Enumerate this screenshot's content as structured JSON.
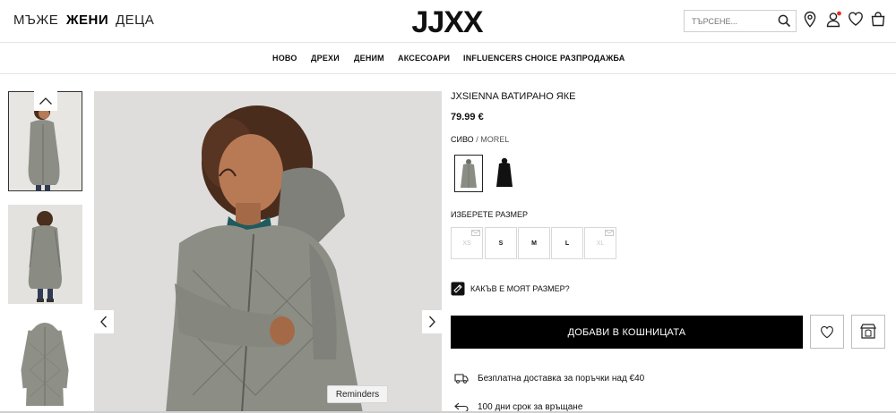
{
  "header": {
    "genders": [
      "МЪЖЕ",
      "ЖЕНИ",
      "ДЕЦА"
    ],
    "active_gender": "ЖЕНИ",
    "logo_text": "JJXX",
    "search_placeholder": "ТЪРСЕНЕ...",
    "icons": [
      "search-icon",
      "location-icon",
      "user-icon",
      "heart-icon",
      "bag-icon"
    ],
    "notification_color": "#e0312b"
  },
  "nav": {
    "items": [
      "НОВО",
      "ДРЕХИ",
      "ДЕНИМ",
      "АКСЕСОАРИ",
      "INFLUENCERS CHOICE",
      "РАЗПРОДАЖБА"
    ]
  },
  "product": {
    "title": "JXSIENNA ВАТИРАНО ЯКЕ",
    "price": "79.99 €",
    "color_label": "СИВО",
    "color_name": "/ MOREL",
    "swatches": [
      {
        "name": "grey",
        "color": "#8a8d84",
        "selected": true
      },
      {
        "name": "black",
        "color": "#111111",
        "selected": false
      }
    ],
    "size_label": "ИЗБЕРЕТЕ РАЗМЕР",
    "sizes": [
      {
        "label": "XS",
        "available": false
      },
      {
        "label": "S",
        "available": true
      },
      {
        "label": "M",
        "available": true
      },
      {
        "label": "L",
        "available": true
      },
      {
        "label": "XL",
        "available": false
      }
    ],
    "size_guide": "КАКЪВ Е МОЯТ РАЗМЕР?",
    "add_to_bag": "ДОБАВИ В КОШНИЦАТА",
    "delivery": "Безплатна доставка за поръчки над €40",
    "returns": "100 дни срок за връщане"
  },
  "gallery": {
    "thumbnail_count": 3,
    "coat_color": "#8c8e86"
  },
  "widget": {
    "reminders": "Reminders"
  }
}
